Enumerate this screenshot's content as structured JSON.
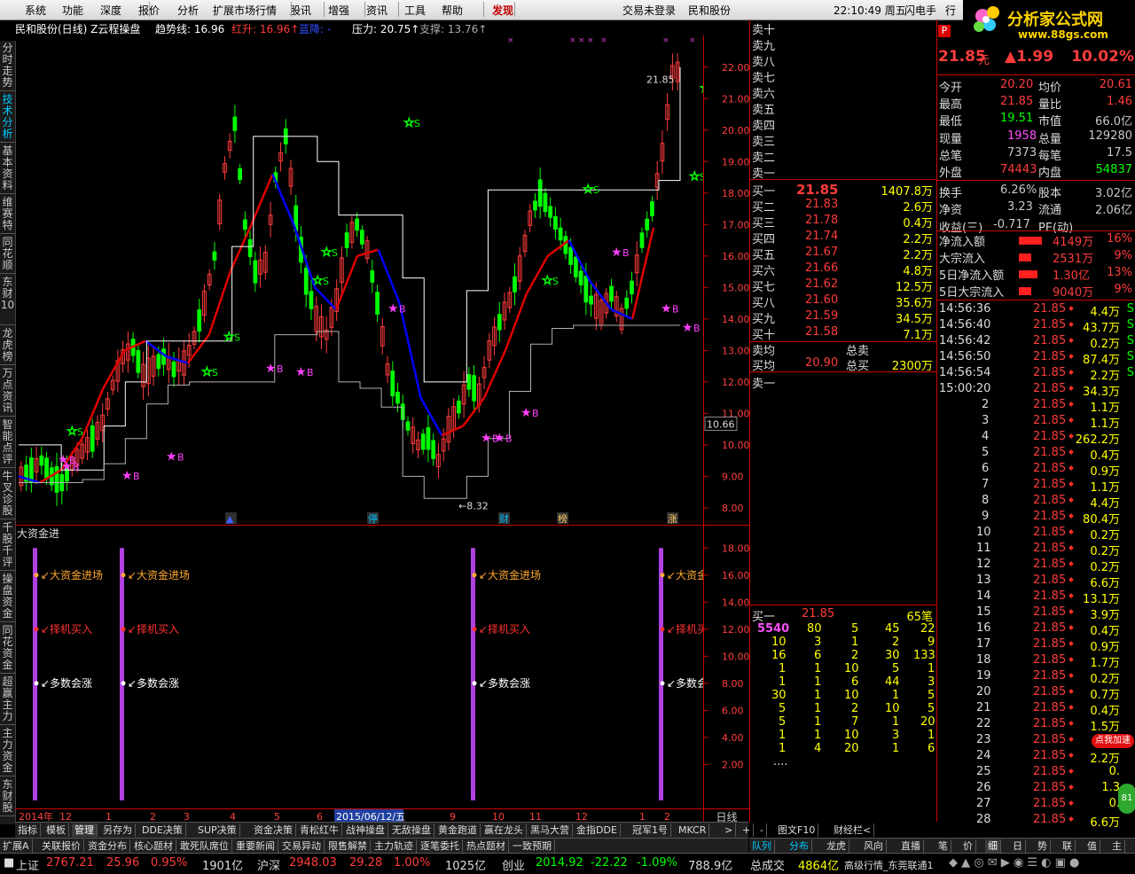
{
  "menu": {
    "items": [
      "系统",
      "功能",
      "深度",
      "报价",
      "分析",
      "扩展市场行情",
      "股讯",
      "增强",
      "资讯",
      "工具",
      "帮助",
      "发现"
    ],
    "login_status": "交易未登录",
    "broker": "民和股份",
    "clock": "22:10:49 周五",
    "flash_trade": "闪电手",
    "row": "行"
  },
  "logo": {
    "text": "分析家公式网",
    "url": "www.88gs.com"
  },
  "chart_head": {
    "stock": "民和股份(日线) Z云程操盘",
    "trend_label": "趋势线: 16.96",
    "red_rise": "红升: 16.96↑",
    "blue_fall": "蓝降: -",
    "pressure": "压力: 20.75↑",
    "support": "支撑: 13.76↑"
  },
  "vtabs": [
    "分时走势",
    "技术分析",
    "基本资料",
    "维赛特",
    "同花顺",
    "东财10",
    "龙虎榜",
    "万点资讯",
    "智能点评",
    "牛叉诊股",
    "千股千评",
    "操盘资金",
    "同花资金",
    "超赢主力",
    "主力资金",
    "东财股"
  ],
  "active_vtab": 1,
  "colors": {
    "up": "#ff3c3c",
    "down": "#00ff00",
    "ma_red": "#e00000",
    "ma_blue": "#0000ff",
    "band": "#ffffff",
    "panel_border": "#c00000",
    "bar": "#b040e0"
  },
  "chart_data": [
    {
      "type": "candlestick",
      "title": "民和股份(日线) Z云程操盘",
      "ylim": [
        7.8,
        22.5
      ],
      "y_ticks": [
        "22.00",
        "21.00",
        "20.00",
        "19.00",
        "18.00",
        "17.00",
        "16.00",
        "15.00",
        "14.00",
        "13.00",
        "12.00",
        "11.00",
        "10.00",
        "9.00",
        "8.00"
      ],
      "annotations": [
        "21.85",
        "8.32"
      ],
      "current_price_tag": "10.66",
      "series": [
        {
          "name": "趋势线",
          "values": [
            9.0,
            8.8,
            9.2,
            10.2,
            11.8,
            13.0,
            13.3,
            12.8,
            12.6,
            13.5,
            15.5,
            17.0,
            18.6,
            17.0,
            15.0,
            14.3,
            16.0,
            16.2,
            14.5,
            11.5,
            10.3,
            10.6,
            11.5,
            13.0,
            14.8,
            16.0,
            16.5,
            15.2,
            14.3,
            14.0,
            16.9
          ]
        },
        {
          "name": "红升",
          "values": [
            16.96
          ]
        },
        {
          "name": "压力",
          "values": [
            20.75
          ]
        },
        {
          "name": "支撑",
          "values": [
            13.76
          ]
        }
      ],
      "signals": [
        {
          "label": "S",
          "value": 10.3
        },
        {
          "label": "B",
          "value": 9.2
        },
        {
          "label": "B",
          "value": 9.4
        },
        {
          "label": "B",
          "value": 8.9
        },
        {
          "label": "S",
          "value": 12.2
        },
        {
          "label": "S",
          "value": 13.3
        },
        {
          "label": "B",
          "value": 9.5
        },
        {
          "label": "B",
          "value": 12.3
        },
        {
          "label": "B",
          "value": 12.2
        },
        {
          "label": "S",
          "value": 15.1
        },
        {
          "label": "S",
          "value": 16.0
        },
        {
          "label": "S",
          "value": 20.1
        },
        {
          "label": "B",
          "value": 14.2
        },
        {
          "label": "B",
          "value": 10.1
        },
        {
          "label": "B",
          "value": 10.1
        },
        {
          "label": "B",
          "value": 10.9
        },
        {
          "label": "S",
          "value": 15.1
        },
        {
          "label": "S",
          "value": 18.0
        },
        {
          "label": "B",
          "value": 16.0
        },
        {
          "label": "B",
          "value": 14.2
        },
        {
          "label": "B",
          "value": 13.6
        },
        {
          "label": "S",
          "value": 18.4
        },
        {
          "label": "S",
          "value": 21.2
        }
      ]
    },
    {
      "type": "bar",
      "title": "大资金进",
      "ylim": [
        0,
        19
      ],
      "y_ticks": [
        "18.00",
        "16.00",
        "14.00",
        "12.00",
        "10.00",
        "8.00",
        "6.00",
        "4.00",
        "2.00"
      ],
      "labels": [
        "大资金进场",
        "择机买入",
        "多数会涨"
      ],
      "label_values": [
        16.0,
        12.0,
        8.0
      ],
      "bar_values": [
        18,
        18,
        18,
        18
      ]
    }
  ],
  "x_axis": [
    "2014年",
    "12",
    "1",
    "2",
    "3",
    "4",
    "5",
    "6",
    "2015/06/12/五",
    "9",
    "10",
    "11",
    "12",
    "1",
    "2"
  ],
  "period": "日线",
  "markers": [
    "停",
    "财",
    "榜",
    "涨"
  ],
  "tabs1": [
    "指标",
    "模板",
    "管理",
    "另存为",
    "DDE决策",
    "SUP决策",
    "资金决策",
    "青松红牛",
    "战神操盘",
    "无敌操盘",
    "黄金跑道",
    "赢在龙头",
    "黑马大营",
    "金指DDE",
    "冠军1号",
    "MKCR",
    ">",
    "+",
    "-",
    "图文F10",
    "财经栏<"
  ],
  "tabs1_active": 2,
  "tabs2": [
    "扩展A",
    "关联报价",
    "资金分布",
    "核心题材",
    "敢死队席位",
    "重要新闻",
    "交易异动",
    "限售解禁",
    "主力轨迹",
    "逐笔委托",
    "热点题材",
    "一致预期"
  ],
  "ask_labels": [
    "卖十",
    "卖九",
    "卖八",
    "卖七",
    "卖六",
    "卖五",
    "卖四",
    "卖三",
    "卖二",
    "卖一"
  ],
  "bids": [
    {
      "label": "买一",
      "price": "21.85",
      "vol": "1407.8万"
    },
    {
      "label": "买二",
      "price": "21.83",
      "vol": "2.6万"
    },
    {
      "label": "买三",
      "price": "21.78",
      "vol": "0.4万"
    },
    {
      "label": "买四",
      "price": "21.74",
      "vol": "2.2万"
    },
    {
      "label": "买五",
      "price": "21.67",
      "vol": "2.2万"
    },
    {
      "label": "买六",
      "price": "21.66",
      "vol": "4.8万"
    },
    {
      "label": "买七",
      "price": "21.62",
      "vol": "12.5万"
    },
    {
      "label": "买八",
      "price": "21.60",
      "vol": "35.6万"
    },
    {
      "label": "买九",
      "price": "21.59",
      "vol": "34.5万"
    },
    {
      "label": "买十",
      "price": "21.58",
      "vol": "7.1万"
    }
  ],
  "avg": {
    "ask_label": "卖均",
    "ask_total_label": "总卖",
    "bid_label": "买均",
    "bid_price": "20.90",
    "bid_total_label": "总买",
    "bid_total": "2300万"
  },
  "sell1_label": "卖一",
  "queue": {
    "header": {
      "label": "买一",
      "price": "21.85",
      "count": "65笔"
    },
    "rows": [
      [
        "5540",
        "80",
        "5",
        "45",
        "22"
      ],
      [
        "10",
        "3",
        "1",
        "2",
        "9"
      ],
      [
        "16",
        "6",
        "2",
        "30",
        "133"
      ],
      [
        "1",
        "1",
        "10",
        "5",
        "1"
      ],
      [
        "1",
        "1",
        "6",
        "44",
        "3"
      ],
      [
        "30",
        "1",
        "10",
        "1",
        "5"
      ],
      [
        "5",
        "1",
        "2",
        "10",
        "5"
      ],
      [
        "5",
        "1",
        "7",
        "1",
        "20"
      ],
      [
        "1",
        "1",
        "10",
        "3",
        "1"
      ],
      [
        "1",
        "4",
        "20",
        "1",
        "6"
      ]
    ],
    "more": "...."
  },
  "quote": {
    "price": "21.85",
    "unit": "元",
    "change": "▲1.99",
    "pct": "10.02%",
    "rows": [
      [
        {
          "k": "今开",
          "v": "20.20",
          "c": "red"
        },
        {
          "k": "均价",
          "v": "20.61",
          "c": "red"
        }
      ],
      [
        {
          "k": "最高",
          "v": "21.85",
          "c": "red"
        },
        {
          "k": "量比",
          "v": "1.46",
          "c": "red"
        }
      ],
      [
        {
          "k": "最低",
          "v": "19.51",
          "c": "grn"
        },
        {
          "k": "市值",
          "v": "66.0亿",
          "c": "gry"
        }
      ],
      [
        {
          "k": "现量",
          "v": "1958",
          "c": "mag"
        },
        {
          "k": "总量",
          "v": "129280",
          "c": "gry"
        }
      ],
      [
        {
          "k": "总笔",
          "v": "7373",
          "c": "gry"
        },
        {
          "k": "每笔",
          "v": "17.5",
          "c": "gry"
        }
      ],
      [
        {
          "k": "外盘",
          "v": "74443",
          "c": "red"
        },
        {
          "k": "内盘",
          "v": "54837",
          "c": "grn"
        }
      ],
      [
        {
          "k": "换手",
          "v": "6.26%",
          "c": "gry"
        },
        {
          "k": "股本",
          "v": "3.02亿",
          "c": "gry"
        }
      ],
      [
        {
          "k": "净资",
          "v": "3.23",
          "c": "gry"
        },
        {
          "k": "流通",
          "v": "2.06亿",
          "c": "gry"
        }
      ],
      [
        {
          "k": "收益(三)",
          "v": "-0.717",
          "c": "gry"
        },
        {
          "k": "PE(动)",
          "v": "",
          "c": "gry"
        }
      ]
    ],
    "flows": [
      {
        "k": "净流入额",
        "v": "4149万",
        "p": "16%",
        "bar": 0.16
      },
      {
        "k": "大宗流入",
        "v": "2531万",
        "p": "9%",
        "bar": 0.09
      },
      {
        "k": "5日净流入额",
        "v": "1.30亿",
        "p": "13%",
        "bar": 0.13
      },
      {
        "k": "5日大宗流入",
        "v": "9040万",
        "p": "9%",
        "bar": 0.09
      }
    ]
  },
  "ticks": [
    [
      "14:56:36",
      "21.85",
      "4.4万",
      "S"
    ],
    [
      "14:56:40",
      "21.85",
      "43.7万",
      "S"
    ],
    [
      "14:56:42",
      "21.85",
      "0.2万",
      "S"
    ],
    [
      "14:56:50",
      "21.85",
      "87.4万",
      "S"
    ],
    [
      "14:56:54",
      "21.85",
      "2.2万",
      "S"
    ],
    [
      "15:00:20",
      "21.85",
      "34.3万",
      ""
    ],
    [
      "2",
      "21.85",
      "1.1万",
      ""
    ],
    [
      "3",
      "21.85",
      "1.1万",
      ""
    ],
    [
      "4",
      "21.85",
      "262.2万",
      ""
    ],
    [
      "5",
      "21.85",
      "0.4万",
      ""
    ],
    [
      "6",
      "21.85",
      "0.9万",
      ""
    ],
    [
      "7",
      "21.85",
      "1.1万",
      ""
    ],
    [
      "8",
      "21.85",
      "4.4万",
      ""
    ],
    [
      "9",
      "21.85",
      "80.4万",
      ""
    ],
    [
      "10",
      "21.85",
      "0.2万",
      ""
    ],
    [
      "11",
      "21.85",
      "0.2万",
      ""
    ],
    [
      "12",
      "21.85",
      "0.2万",
      ""
    ],
    [
      "13",
      "21.85",
      "6.6万",
      ""
    ],
    [
      "14",
      "21.85",
      "13.1万",
      ""
    ],
    [
      "15",
      "21.85",
      "3.9万",
      ""
    ],
    [
      "16",
      "21.85",
      "0.4万",
      ""
    ],
    [
      "17",
      "21.85",
      "0.9万",
      ""
    ],
    [
      "18",
      "21.85",
      "1.7万",
      ""
    ],
    [
      "19",
      "21.85",
      "0.2万",
      ""
    ],
    [
      "20",
      "21.85",
      "0.7万",
      ""
    ],
    [
      "21",
      "21.85",
      "0.4万",
      ""
    ],
    [
      "22",
      "21.85",
      "1.5万",
      ""
    ],
    [
      "23",
      "21.85",
      "",
      ""
    ],
    [
      "24",
      "21.85",
      "2.2万",
      ""
    ],
    [
      "25",
      "21.85",
      "0.",
      ""
    ],
    [
      "26",
      "21.85",
      "1.3",
      ""
    ],
    [
      "27",
      "21.85",
      "0.",
      ""
    ],
    [
      "28",
      "21.85",
      "6.6万",
      ""
    ]
  ],
  "right_tabs": [
    "队列",
    "分布",
    "龙虎",
    "风向",
    "直播",
    "笔",
    "价",
    "细",
    "日",
    "势",
    "联",
    "值",
    "主"
  ],
  "right_tabs_active": 7,
  "badge": {
    "label": "点我加速",
    "count": "81"
  },
  "status": {
    "sh_label": "上证",
    "sh_val": "2767.21",
    "sh_chg": "25.96",
    "sh_pct": "0.95%",
    "sh_amt": "1901亿",
    "hs_label": "沪深",
    "hs_val": "2948.03",
    "hs_chg": "29.28",
    "hs_pct": "1.00%",
    "hs_amt": "1025亿",
    "cy_label": "创业",
    "cy_val": "2014.92",
    "cy_chg": "-22.22",
    "cy_pct": "-1.09%",
    "cy_amt": "788.9亿",
    "turnover_label": "总成交",
    "turnover": "4864亿",
    "feed": "高级行情_东莞联通1"
  }
}
